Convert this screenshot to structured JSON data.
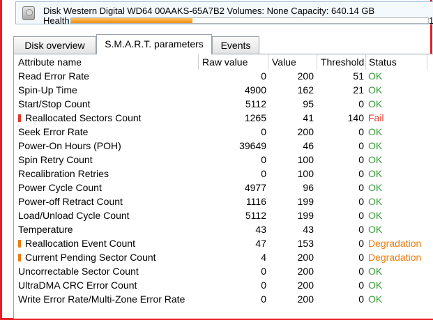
{
  "header": {
    "title": "Disk Western Digital WD64 00AAKS-65A7B2   Volumes: None   Capacity: 640.14 GB",
    "health_label": "Health:",
    "health_value_partial": "1",
    "health_fraction": 0.34,
    "health_color": "#f28c0d"
  },
  "tabs": [
    {
      "label": "Disk overview",
      "active": false
    },
    {
      "label": "S.M.A.R.T. parameters",
      "active": true
    },
    {
      "label": "Events",
      "active": false
    }
  ],
  "columns": {
    "name": "Attribute name",
    "raw": "Raw value",
    "value": "Value",
    "threshold": "Threshold",
    "status": "Status"
  },
  "status_colors": {
    "OK": "#3a9a3a",
    "Fail": "#e2372e",
    "Degradation": "#ea7d0c"
  },
  "rows": [
    {
      "name": "Read Error Rate",
      "raw": "0",
      "value": "200",
      "threshold": "51",
      "status": "OK",
      "marker": ""
    },
    {
      "name": "Spin-Up Time",
      "raw": "4900",
      "value": "162",
      "threshold": "21",
      "status": "OK",
      "marker": ""
    },
    {
      "name": "Start/Stop Count",
      "raw": "5112",
      "value": "95",
      "threshold": "0",
      "status": "OK",
      "marker": ""
    },
    {
      "name": "Reallocated Sectors Count",
      "raw": "1265",
      "value": "41",
      "threshold": "140",
      "status": "Fail",
      "marker": "#e2372e"
    },
    {
      "name": "Seek Error Rate",
      "raw": "0",
      "value": "200",
      "threshold": "0",
      "status": "OK",
      "marker": ""
    },
    {
      "name": "Power-On Hours (POH)",
      "raw": "39649",
      "value": "46",
      "threshold": "0",
      "status": "OK",
      "marker": ""
    },
    {
      "name": "Spin Retry Count",
      "raw": "0",
      "value": "100",
      "threshold": "0",
      "status": "OK",
      "marker": ""
    },
    {
      "name": "Recalibration Retries",
      "raw": "0",
      "value": "100",
      "threshold": "0",
      "status": "OK",
      "marker": ""
    },
    {
      "name": "Power Cycle Count",
      "raw": "4977",
      "value": "96",
      "threshold": "0",
      "status": "OK",
      "marker": ""
    },
    {
      "name": "Power-off Retract Count",
      "raw": "1116",
      "value": "199",
      "threshold": "0",
      "status": "OK",
      "marker": ""
    },
    {
      "name": "Load/Unload Cycle Count",
      "raw": "5112",
      "value": "199",
      "threshold": "0",
      "status": "OK",
      "marker": ""
    },
    {
      "name": "Temperature",
      "raw": "43",
      "value": "43",
      "threshold": "0",
      "status": "OK",
      "marker": ""
    },
    {
      "name": "Reallocation Event Count",
      "raw": "47",
      "value": "153",
      "threshold": "0",
      "status": "Degradation",
      "marker": "#ea7d0c"
    },
    {
      "name": "Current Pending Sector Count",
      "raw": "4",
      "value": "200",
      "threshold": "0",
      "status": "Degradation",
      "marker": "#ea7d0c"
    },
    {
      "name": "Uncorrectable Sector Count",
      "raw": "0",
      "value": "200",
      "threshold": "0",
      "status": "OK",
      "marker": ""
    },
    {
      "name": "UltraDMA CRC Error Count",
      "raw": "0",
      "value": "200",
      "threshold": "0",
      "status": "OK",
      "marker": ""
    },
    {
      "name": "Write Error Rate/Multi-Zone Error Rate",
      "raw": "0",
      "value": "200",
      "threshold": "0",
      "status": "OK",
      "marker": ""
    }
  ]
}
